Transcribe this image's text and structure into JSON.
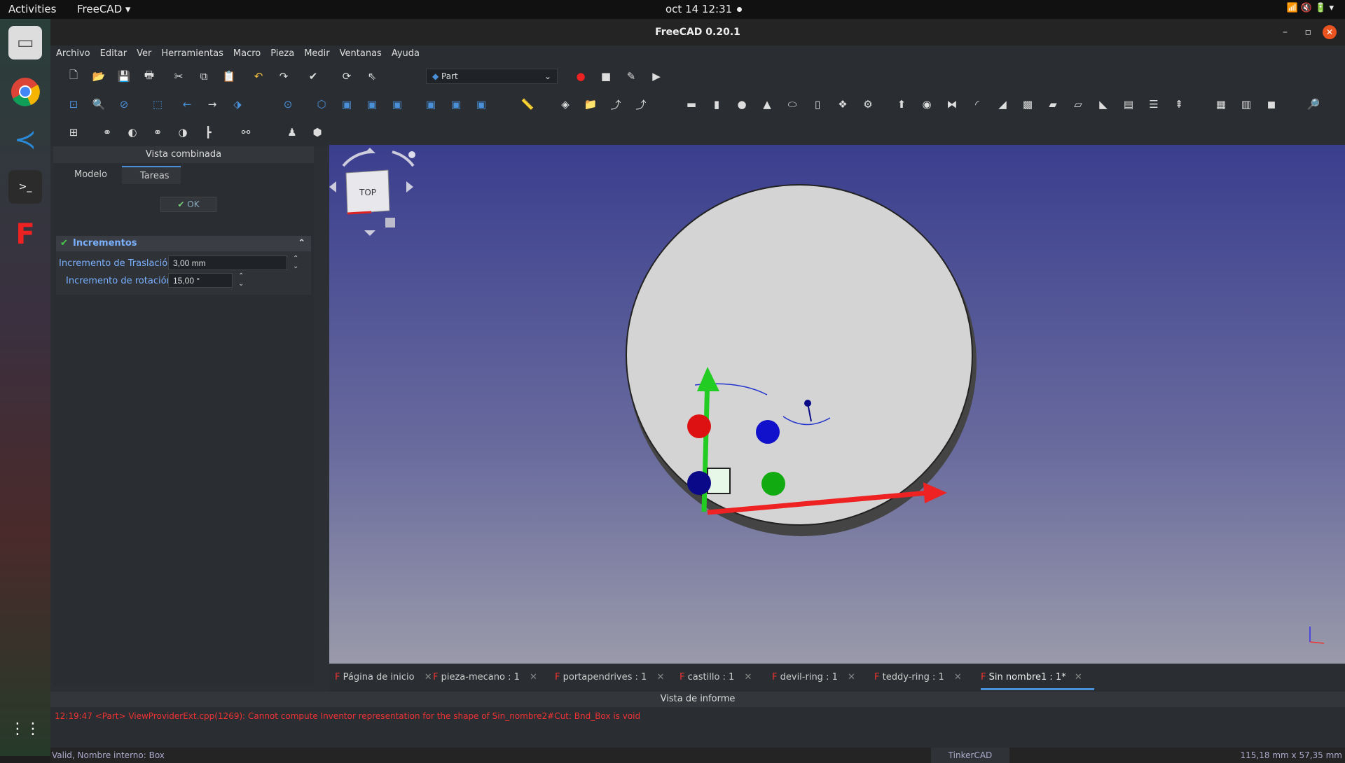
{
  "topbar": {
    "activities": "Activities",
    "app": "FreeCAD ▾",
    "clock": "oct 14  12:31"
  },
  "window": {
    "title": "FreeCAD 0.20.1"
  },
  "menu": [
    "Archivo",
    "Editar",
    "Ver",
    "Herramientas",
    "Macro",
    "Pieza",
    "Medir",
    "Ventanas",
    "Ayuda"
  ],
  "workbench": "Part",
  "combo": {
    "title": "Vista combinada",
    "tab_model": "Modelo",
    "tab_tasks": "Tareas",
    "ok": "OK"
  },
  "panel": {
    "title": "Incrementos",
    "trans_label": "Incremento de Traslación:",
    "trans_value": "3,00 mm",
    "rot_label": "Incremento de rotación:",
    "rot_value": "15,00 °"
  },
  "navcube": {
    "face": "TOP"
  },
  "doctabs": [
    "Página de inicio",
    "pieza-mecano : 1",
    "portapendrives : 1",
    "castillo : 1",
    "devil-ring : 1",
    "teddy-ring : 1",
    "Sin nombre1 : 1*"
  ],
  "report": {
    "title": "Vista de informe",
    "message": "12:19:47  <Part> ViewProviderExt.cpp(1269): Cannot compute Inventor representation for the shape of Sin_nombre2#Cut: Bnd_Box is void"
  },
  "status": {
    "left": "Valid, Nombre interno: Box",
    "mode": "TinkerCAD",
    "dims": "115,18 mm x 57,35 mm"
  },
  "colors": {
    "accent": "#4a90d9",
    "error": "#e33333"
  }
}
